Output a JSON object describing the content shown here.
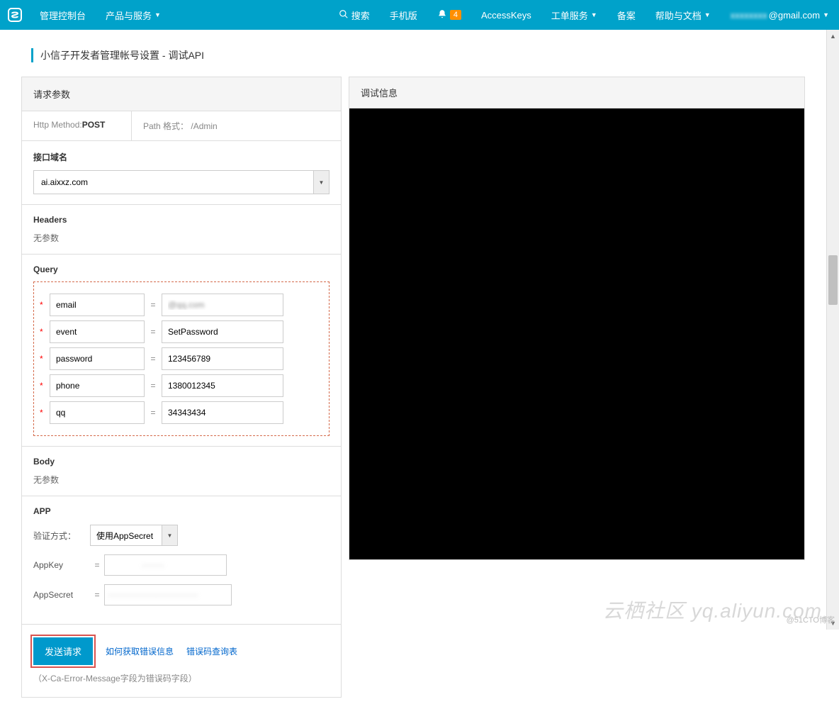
{
  "header": {
    "console": "管理控制台",
    "products": "产品与服务",
    "search": "搜索",
    "mobile": "手机版",
    "notif_count": "4",
    "access_keys": "AccessKeys",
    "work_orders": "工单服务",
    "beian": "备案",
    "help": "帮助与文档",
    "user_suffix": "@gmail.com"
  },
  "page_title": "小信子开发者管理帐号设置 - 调试API",
  "request": {
    "panel_title": "请求参数",
    "http_method_label": "Http Method:",
    "http_method_value": "POST",
    "path_label": "Path 格式：",
    "path_value": "/Admin",
    "domain_label": "接口域名",
    "domain_value": "ai.aixxz.com",
    "headers_label": "Headers",
    "headers_text": "无参数",
    "query_label": "Query",
    "query": [
      {
        "key": "email",
        "val": "@qq.com"
      },
      {
        "key": "event",
        "val": "SetPassword"
      },
      {
        "key": "password",
        "val": "123456789"
      },
      {
        "key": "phone",
        "val": "1380012345"
      },
      {
        "key": "qq",
        "val": "34343434"
      }
    ],
    "body_label": "Body",
    "body_text": "无参数",
    "app_label": "APP",
    "auth_label": "验证方式：",
    "auth_value": "使用AppSecret",
    "appkey_label": "AppKey",
    "appkey_value": "········",
    "appsecret_label": "AppSecret",
    "appsecret_value": "································"
  },
  "submit": {
    "button": "发送请求",
    "link_error_info": "如何获取错误信息",
    "link_error_table": "错误码查询表",
    "help_text": "（X-Ca-Error-Message字段为错误码字段）"
  },
  "debug": {
    "title": "调试信息"
  },
  "watermark_right": "@51CTO博客",
  "watermark_center": "云栖社区 yq.aliyun.com"
}
